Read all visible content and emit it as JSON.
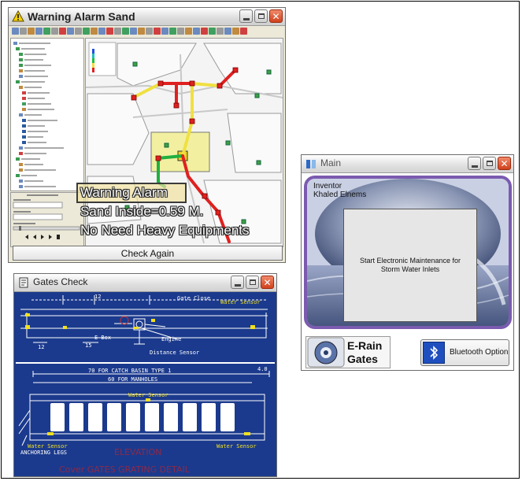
{
  "window_warning": {
    "title": "Warning Alarm Sand",
    "alarm_title": "Warning Alarm",
    "sand_line": "Sand Inside=0.59 M.",
    "equip_line": "No Need Heavy Equipments",
    "check_button": "Check Again"
  },
  "window_gates": {
    "title": "Gates Check",
    "labels": {
      "gate_close": "Gate Close",
      "water_sensor_top": "Water Sensor",
      "e_box": "E-Box",
      "engine": "Engine",
      "distance_sensor": "Distance Sensor",
      "catch_basin": "70 FOR CATCH BASIN TYPE 1",
      "manholes": "60 FOR MANHOLES",
      "water_sensor_mid": "Water Sensor",
      "water_sensor_left": "Water Sensor",
      "anchoring": "ANCHORING LEGS",
      "water_sensor_right": "Water Sensor",
      "elevation": "ELEVATION",
      "footer": "Cover GATES GRATING DETAIL",
      "dim_12": "12",
      "dim_12b": "12",
      "dim_15": "15",
      "dim_40": "4.0"
    }
  },
  "window_main": {
    "title": "Main",
    "inventor_label": "Inventor",
    "inventor_name": "Khaled Elnems",
    "start_text": "Start Electronic Maintenance for Storm Water Inlets",
    "logo_text_1": "E-Rain",
    "logo_text_2": "Gates",
    "bluetooth_button": "Bluetooth Option"
  },
  "icons": [
    "warning-icon",
    "minimize-icon",
    "maximize-icon",
    "close-icon",
    "gates-app-icon",
    "main-app-icon",
    "bluetooth-icon"
  ],
  "colors": {
    "blueprint_bg": "#1b3a8d",
    "pipe_red": "#e02020",
    "pipe_yellow": "#f0e040",
    "pipe_green": "#20b040",
    "highlight_zone": "#f2f0a0"
  }
}
